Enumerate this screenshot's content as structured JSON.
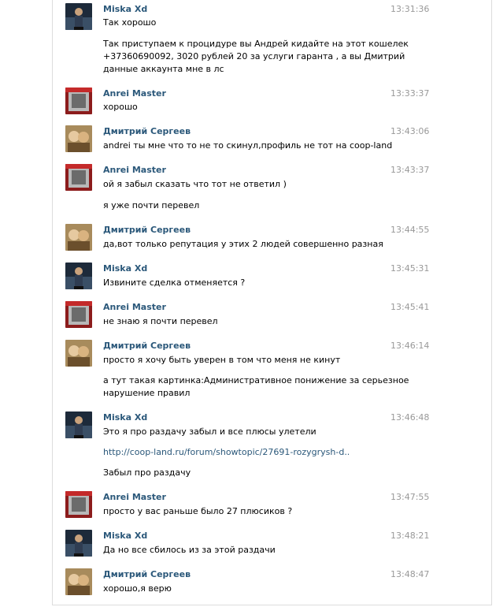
{
  "messages": [
    {
      "author": "Miska Xd",
      "time": "13:31:36",
      "avatar": "miska",
      "lines": [
        [
          "Так хорошо"
        ],
        [
          "Так приступаем к процидуре вы Андрей кидайте на этот кошелек",
          "+37360690092, 3020 рублей 20 за услуги гаранта , а вы Дмитрий",
          "данные аккаунта мне в лс"
        ]
      ]
    },
    {
      "author": "Anrei Master",
      "time": "13:33:37",
      "avatar": "anrei",
      "lines": [
        [
          "хорошо"
        ]
      ]
    },
    {
      "author": "Дмитрий Сергеев",
      "time": "13:43:06",
      "avatar": "dmitry",
      "lines": [
        [
          "andrei ты мне что то не то скинул,профиль не тот на coop-land"
        ]
      ]
    },
    {
      "author": "Anrei Master",
      "time": "13:43:37",
      "avatar": "anrei",
      "lines": [
        [
          "ой я забыл сказать что тот не ответил )"
        ],
        [
          "я уже почти перевел"
        ]
      ]
    },
    {
      "author": "Дмитрий Сергеев",
      "time": "13:44:55",
      "avatar": "dmitry",
      "lines": [
        [
          "да,вот только репутация у этих 2 людей совершенно разная"
        ]
      ]
    },
    {
      "author": "Miska Xd",
      "time": "13:45:31",
      "avatar": "miska",
      "lines": [
        [
          "Извините сделка отменяется ?"
        ]
      ]
    },
    {
      "author": "Anrei Master",
      "time": "13:45:41",
      "avatar": "anrei",
      "lines": [
        [
          "не знаю я почти перевел"
        ]
      ]
    },
    {
      "author": "Дмитрий Сергеев",
      "time": "13:46:14",
      "avatar": "dmitry",
      "lines": [
        [
          "просто я хочу быть уверен в том что меня не кинут"
        ],
        [
          "а тут такая картинка:Административное понижение за серьезное",
          "нарушение правил"
        ]
      ]
    },
    {
      "author": "Miska Xd",
      "time": "13:46:48",
      "avatar": "miska",
      "lines": [
        [
          "Это я про раздачу забыл и все плюсы улетели"
        ],
        [
          "http://coop-land.ru/forum/showtopic/27691-rozygrysh-d.."
        ],
        [
          "Забыл про раздачу"
        ]
      ]
    },
    {
      "author": "Anrei Master",
      "time": "13:47:55",
      "avatar": "anrei",
      "lines": [
        [
          "просто у вас раньше было 27 плюсиков ?"
        ]
      ]
    },
    {
      "author": "Miska Xd",
      "time": "13:48:21",
      "avatar": "miska",
      "lines": [
        [
          "Да но все сбилось из за этой раздачи"
        ]
      ]
    },
    {
      "author": "Дмитрий Сергеев",
      "time": "13:48:47",
      "avatar": "dmitry",
      "lines": [
        [
          "хорошо,я верю"
        ]
      ]
    }
  ],
  "colors": {
    "author": "#2b587a",
    "time": "#999999",
    "text": "#000000",
    "link": "#2b587a"
  }
}
